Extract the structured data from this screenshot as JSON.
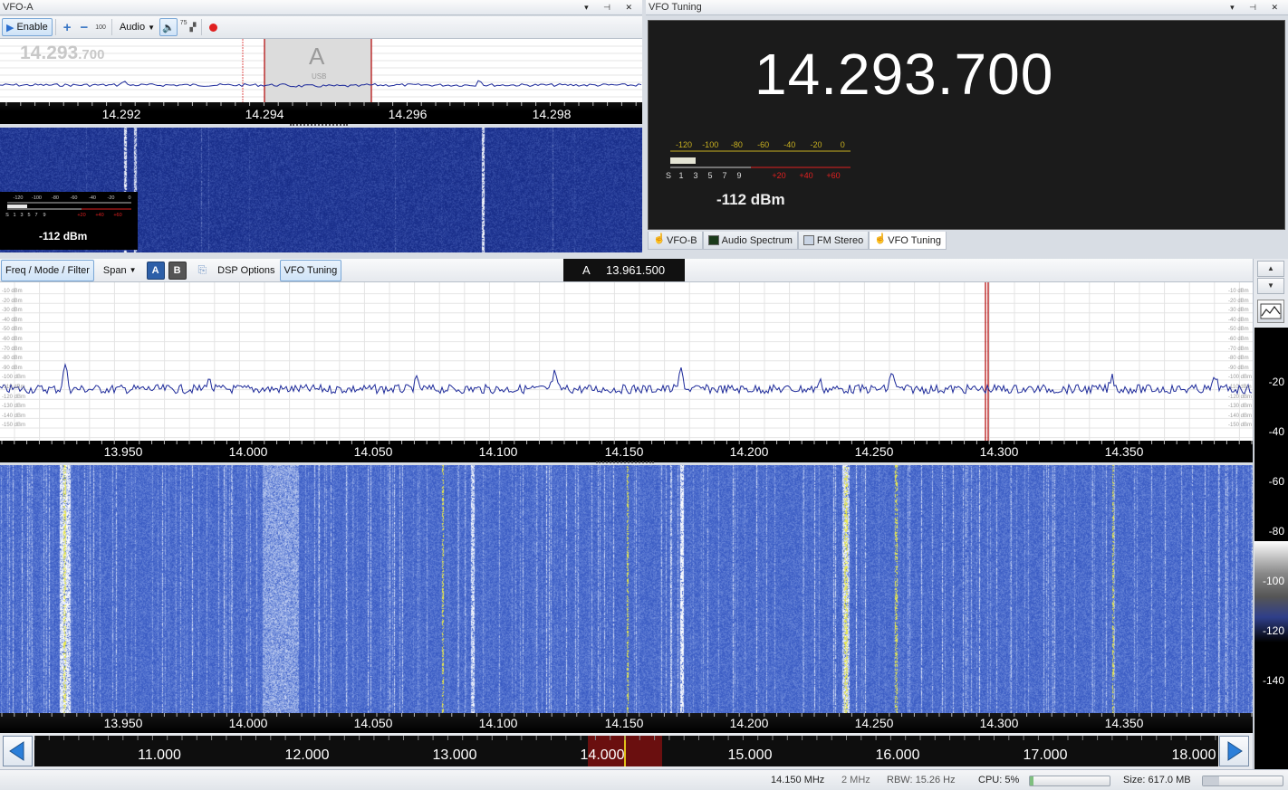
{
  "vfo_a_panel": {
    "title": "VFO-A",
    "toolbar": {
      "enable_label": "Enable",
      "volume_value": "100",
      "audio_label": "Audio",
      "squelch_value": "75"
    },
    "freq_ghost_main": "14.293",
    "freq_ghost_sub": ".700",
    "vfo_letter": "A",
    "vfo_mode": "USB",
    "scale_ticks": [
      {
        "label": "14.292",
        "pos": 134
      },
      {
        "label": "14.294",
        "pos": 292
      },
      {
        "label": "14.296",
        "pos": 450
      },
      {
        "label": "14.298",
        "pos": 609
      }
    ],
    "smeter": {
      "scale_top": [
        "-120",
        "-100",
        "-80",
        "-60",
        "-40",
        "-20",
        "0"
      ],
      "scale_bottom": [
        "S",
        "1",
        "3",
        "5",
        "7",
        "9",
        "+20",
        "+40",
        "+60"
      ],
      "reading": "-112 dBm"
    }
  },
  "vfo_tuning_panel": {
    "title": "VFO Tuning",
    "frequency": "14.293.700",
    "smeter": {
      "scale_top": [
        "-120",
        "-100",
        "-80",
        "-60",
        "-40",
        "-20",
        "0"
      ],
      "scale_bottom": [
        "S",
        "1",
        "3",
        "5",
        "7",
        "9",
        "+20",
        "+40",
        "+60"
      ],
      "reading": "-112 dBm"
    },
    "tabs": [
      {
        "label": "VFO-B",
        "icon": "hand-icon"
      },
      {
        "label": "Audio Spectrum",
        "icon": "spectrum-icon"
      },
      {
        "label": "FM Stereo",
        "icon": "radio-icon"
      },
      {
        "label": "VFO Tuning",
        "icon": "hand-icon"
      }
    ]
  },
  "main_panel": {
    "toolbar": {
      "freq_mode_filter": "Freq / Mode / Filter",
      "span": "Span",
      "vfo_a": "A",
      "vfo_b": "B",
      "dsp_options": "DSP Options",
      "vfo_tuning": "VFO Tuning"
    },
    "cursor_label_letter": "A",
    "cursor_label_freq": "13.961.500",
    "dbm_labels": [
      "-10 dBm",
      "-20 dBm",
      "-30 dBm",
      "-40 dBm",
      "-50 dBm",
      "-60 dBm",
      "-70 dBm",
      "-80 dBm",
      "-90 dBm",
      "-100 dBm",
      "-110 dBm",
      "-120 dBm",
      "-130 dBm",
      "-140 dBm",
      "-150 dBm"
    ],
    "scale_ticks": [
      "13.950",
      "14.000",
      "14.050",
      "14.100",
      "14.150",
      "14.200",
      "14.250",
      "14.300",
      "14.350"
    ],
    "side_scale": [
      "-20",
      "-40",
      "-60",
      "-80",
      "-100",
      "-120",
      "-140"
    ],
    "band_ticks": [
      "11.000",
      "12.000",
      "13.000",
      "14.000",
      "15.000",
      "16.000",
      "17.000",
      "18.000"
    ]
  },
  "status_bar": {
    "center_freq": "14.150 MHz",
    "span": "2 MHz",
    "rbw": "RBW: 15.26 Hz",
    "cpu": "CPU: 5%",
    "cpu_fraction": 0.05,
    "size": "Size: 617.0 MB",
    "size_fraction": 0.2
  },
  "colors": {
    "trace": "#1d2a9a",
    "marker": "#c00000",
    "waterfall_base": "#3d5dbf",
    "waterfall_peak": "#e8e840"
  }
}
